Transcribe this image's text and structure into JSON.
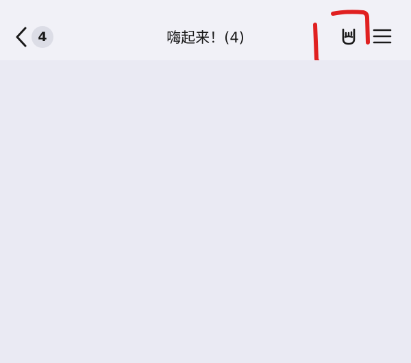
{
  "header": {
    "unread_count": "4",
    "title": "嗨起来！(4)"
  },
  "icons": {
    "back": "chevron-left-icon",
    "rock_on": "rock-on-hand-icon",
    "menu": "hamburger-menu-icon",
    "annotation": "red-hand-drawn-highlight"
  },
  "colors": {
    "header_bg": "#f1f1f7",
    "body_bg": "#eaeaf3",
    "badge_bg": "#dcdde6",
    "annotation": "#e02020"
  }
}
